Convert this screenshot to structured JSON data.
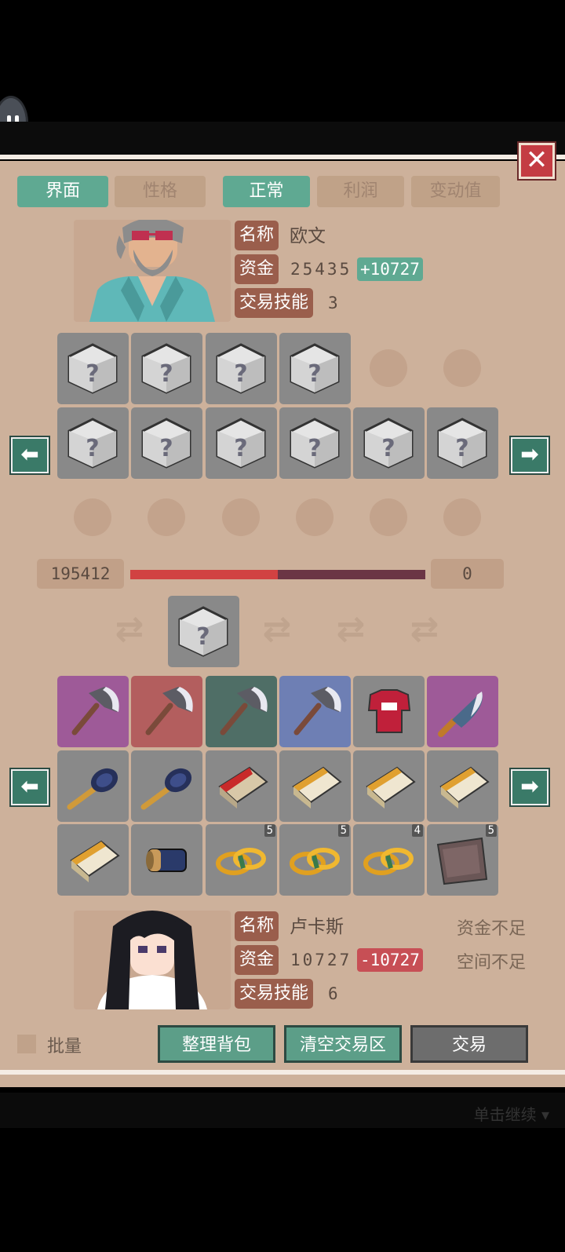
{
  "top_tabs": [
    {
      "label": "界面",
      "active": true
    },
    {
      "label": "性格",
      "active": false
    },
    {
      "label": "正常",
      "active": true
    },
    {
      "label": "利润",
      "active": false
    },
    {
      "label": "变动值",
      "active": false
    }
  ],
  "merchant": {
    "name_label": "名称",
    "name": "欧文",
    "funds_label": "资金",
    "funds": "25435",
    "funds_change": "+10727",
    "skill_label": "交易技能",
    "skill": "3"
  },
  "trade_bar": {
    "left_value": "195412",
    "right_value": "0",
    "fill_fraction": 0.5
  },
  "player": {
    "name_label": "名称",
    "name": "卢卡斯",
    "funds_label": "资金",
    "funds": "10727",
    "funds_change": "-10727",
    "skill_label": "交易技能",
    "skill": "6",
    "status_funds": "资金不足",
    "status_space": "空间不足"
  },
  "inventory": [
    {
      "item": "axe-icon",
      "rarity_color": "#9e5a98",
      "count": ""
    },
    {
      "item": "axe-icon",
      "rarity_color": "#b35e5e",
      "count": ""
    },
    {
      "item": "axe-icon",
      "rarity_color": "#4f6e66",
      "count": ""
    },
    {
      "item": "axe-icon",
      "rarity_color": "#6e7fb4",
      "count": ""
    },
    {
      "item": "jersey-icon",
      "rarity_color": "#898989",
      "count": ""
    },
    {
      "item": "knife-icon",
      "rarity_color": "#9e5a98",
      "count": ""
    },
    {
      "item": "spoon-icon",
      "rarity_color": "#898989",
      "count": ""
    },
    {
      "item": "spoon-icon",
      "rarity_color": "#898989",
      "count": ""
    },
    {
      "item": "cigarette-pack-red-icon",
      "rarity_color": "#898989",
      "count": ""
    },
    {
      "item": "cigarette-pack-icon",
      "rarity_color": "#898989",
      "count": ""
    },
    {
      "item": "cigarette-pack-icon",
      "rarity_color": "#898989",
      "count": ""
    },
    {
      "item": "cigarette-pack-icon",
      "rarity_color": "#898989",
      "count": ""
    },
    {
      "item": "cigarette-pack-icon",
      "rarity_color": "#898989",
      "count": ""
    },
    {
      "item": "battery-icon",
      "rarity_color": "#898989",
      "count": ""
    },
    {
      "item": "rope-icon",
      "rarity_color": "#898989",
      "count": "5"
    },
    {
      "item": "rope-icon",
      "rarity_color": "#898989",
      "count": "5"
    },
    {
      "item": "rope-icon",
      "rarity_color": "#898989",
      "count": "4"
    },
    {
      "item": "cloth-icon",
      "rarity_color": "#898989",
      "count": "5"
    }
  ],
  "bottom": {
    "batch_label": "批量",
    "sort_label": "整理背包",
    "clear_label": "清空交易区",
    "trade_label": "交易"
  },
  "continue_hint": "单击继续",
  "colors": {
    "accent": "#5fa992",
    "negative": "#c74f55",
    "panel": "#cdb19b"
  }
}
